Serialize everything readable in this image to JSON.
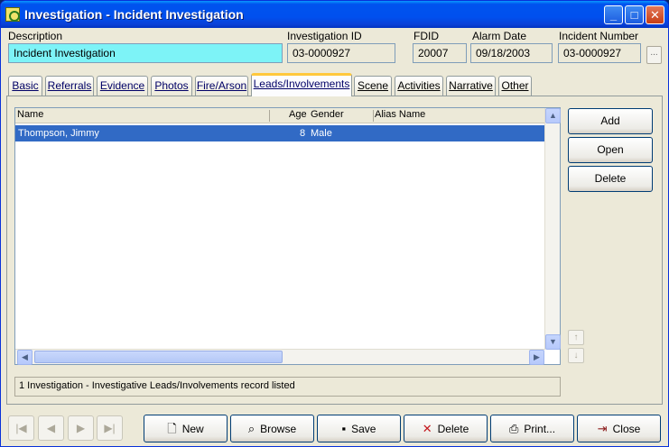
{
  "window": {
    "title": "Investigation - Incident Investigation",
    "minimize_glyph": "_",
    "maximize_glyph": "□",
    "close_glyph": "✕"
  },
  "header": {
    "description_label": "Description",
    "description_value": "Incident Investigation",
    "investigation_id_label": "Investigation ID",
    "investigation_id_value": "03-0000927",
    "fdid_label": "FDID",
    "fdid_value": "20007",
    "alarm_date_label": "Alarm Date",
    "alarm_date_value": "09/18/2003",
    "incident_number_label": "Incident Number",
    "incident_number_value": "03-0000927",
    "lookup_button_label": "..."
  },
  "tabs": [
    {
      "label": "Basic"
    },
    {
      "label": "Referrals"
    },
    {
      "label": "Evidence"
    },
    {
      "label": "Photos"
    },
    {
      "label": "Fire/Arson"
    },
    {
      "label": "Leads/Involvements",
      "active": true
    },
    {
      "label": "Scene"
    },
    {
      "label": "Activities"
    },
    {
      "label": "Narrative"
    },
    {
      "label": "Other"
    }
  ],
  "grid": {
    "columns": [
      "Name",
      "Age",
      "Gender",
      "Alias Name"
    ],
    "rows": [
      {
        "name": "Thompson, Jimmy",
        "age": "8",
        "gender": "Male",
        "alias": "",
        "selected": true
      }
    ]
  },
  "side_buttons": {
    "add": "Add",
    "open": "Open",
    "delete": "Delete"
  },
  "status": "1 Investigation - Investigative Leads/Involvements record listed",
  "toolbar": {
    "new": "New",
    "browse": "Browse",
    "save": "Save",
    "delete": "Delete",
    "print": "Print...",
    "close": "Close"
  },
  "colors": {
    "selection": "#316ac5",
    "titlebar": "#0053ee",
    "description_field": "#7df3f7",
    "active_tab_accent": "#ffc83c"
  }
}
